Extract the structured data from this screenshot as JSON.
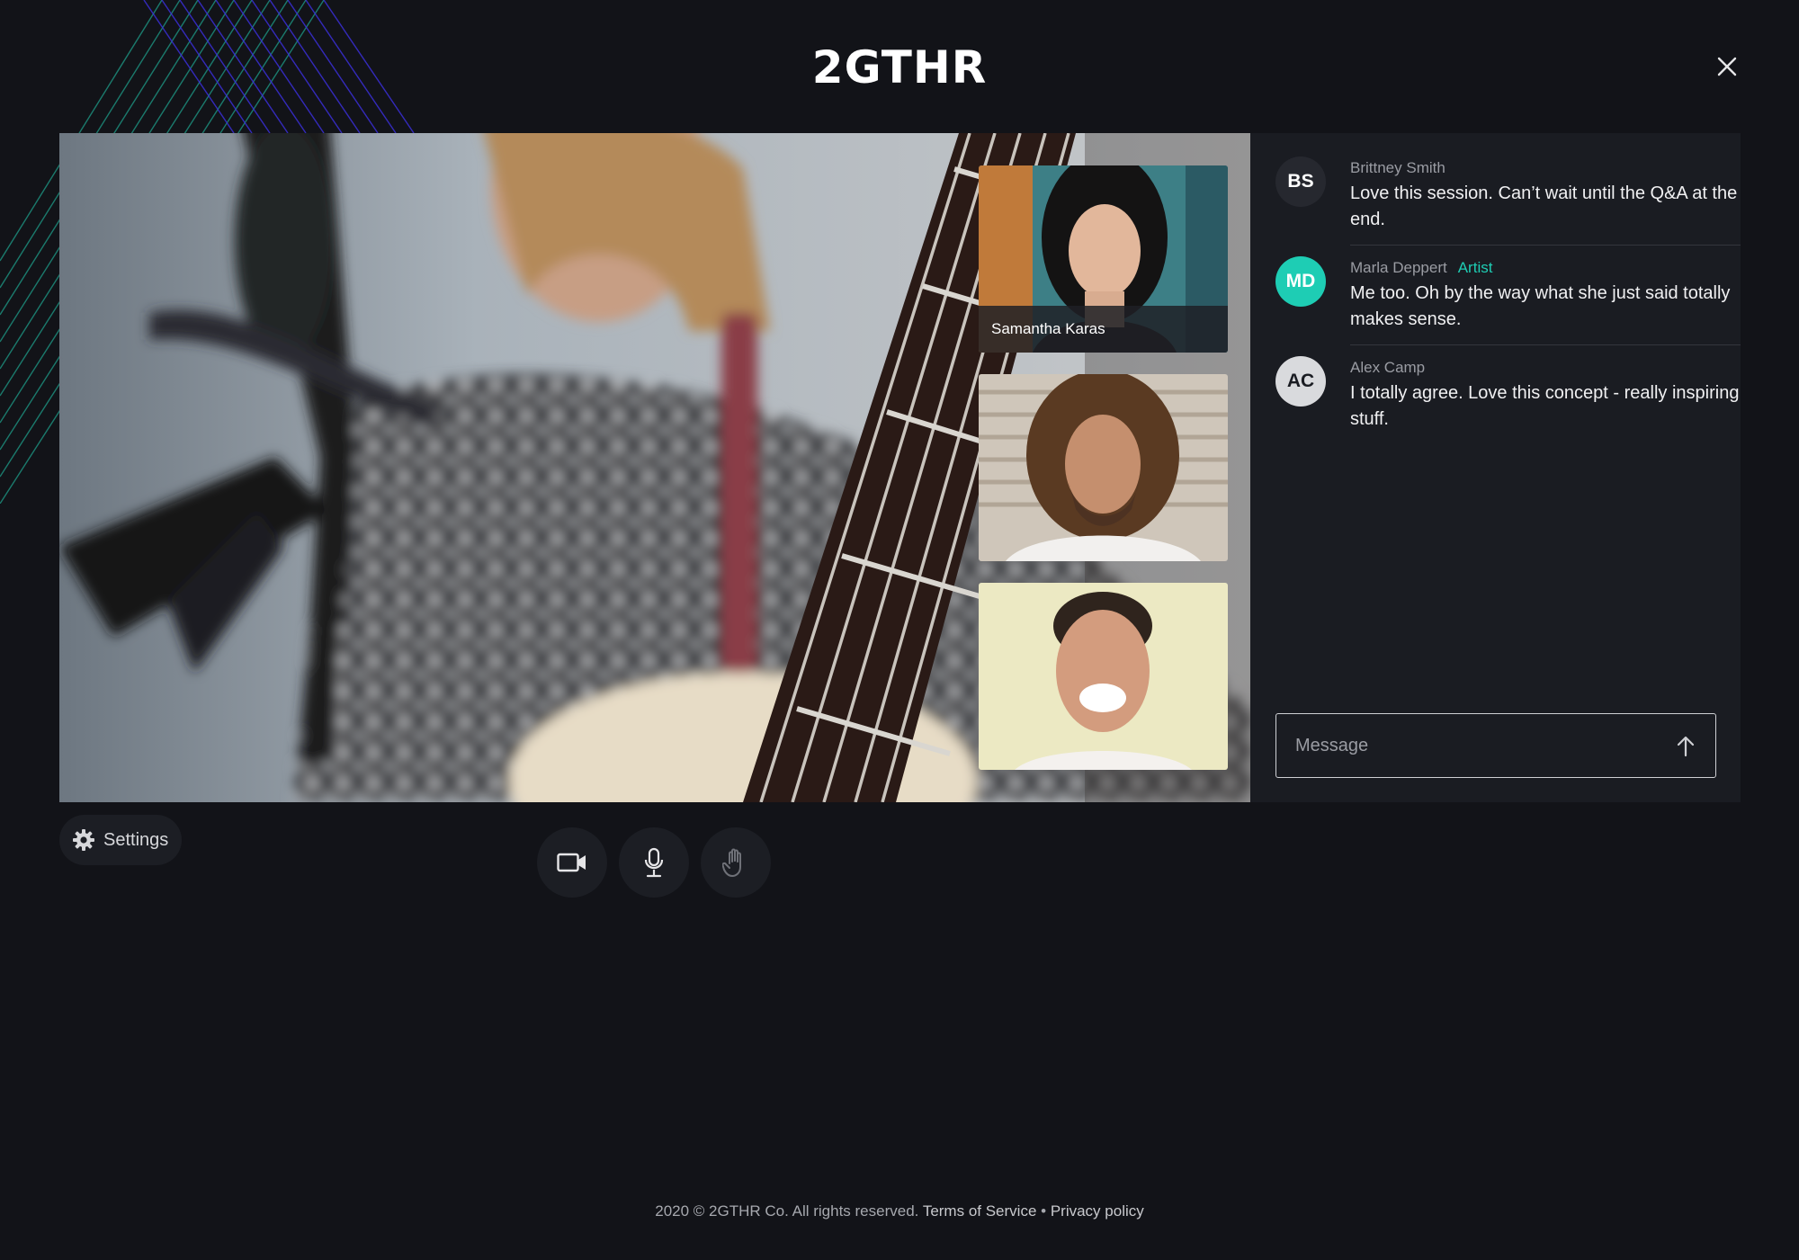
{
  "brand": {
    "logo_text": "2GTHR"
  },
  "window": {
    "close_icon": "close-icon"
  },
  "stage": {
    "participants": [
      {
        "name": "Samantha Karas",
        "label_visible": true
      },
      {
        "name": "",
        "label_visible": false
      },
      {
        "name": "",
        "label_visible": false
      }
    ]
  },
  "chat": {
    "messages": [
      {
        "initials": "BS",
        "name": "Brittney Smith",
        "role": "",
        "text": "Love this session. Can’t wait until the Q&A at the end."
      },
      {
        "initials": "MD",
        "name": "Marla Deppert",
        "role": "Artist",
        "text": "Me too. Oh by the way what she just said totally makes sense."
      },
      {
        "initials": "AC",
        "name": "Alex Camp",
        "role": "",
        "text": "I totally agree. Love this concept - really inspiring stuff."
      }
    ],
    "input": {
      "placeholder": "Message",
      "value": ""
    },
    "send_icon": "arrow-up-icon"
  },
  "controls": {
    "settings_label": "Settings",
    "buttons": [
      {
        "icon": "video-camera-icon"
      },
      {
        "icon": "microphone-icon"
      },
      {
        "icon": "raise-hand-icon"
      }
    ]
  },
  "footer": {
    "copyright": "2020 © 2GTHR Co. All rights reserved.",
    "terms": "Terms of Service",
    "separator": "•",
    "privacy": "Privacy policy"
  },
  "colors": {
    "background": "#121318",
    "panel": "#1a1c22",
    "accent": "#1ecdb4",
    "deco_green": "#1ecdb4",
    "deco_purple": "#3b2fd9"
  }
}
